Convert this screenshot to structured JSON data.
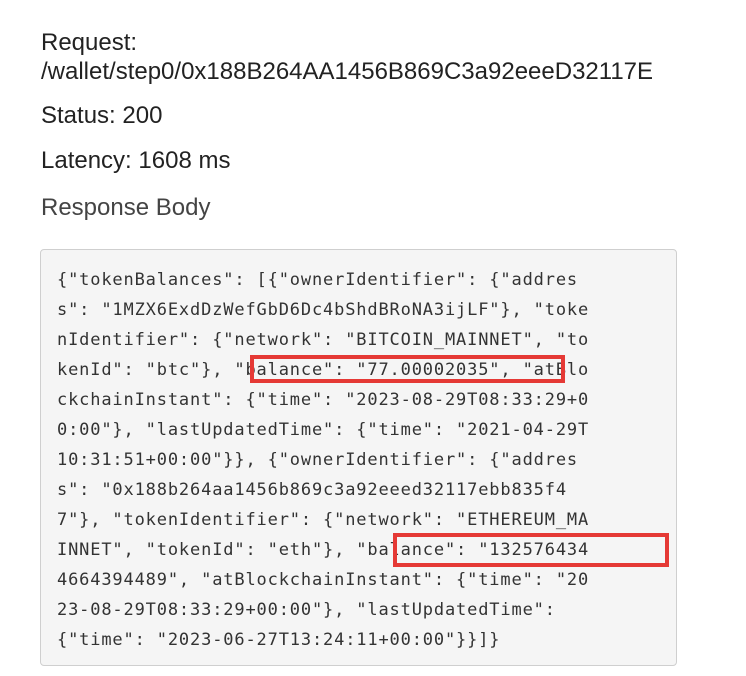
{
  "request": {
    "label": "Request:",
    "url": "/wallet/step0/0x188B264AA1456B869C3a92eeeD32117E"
  },
  "status_text": "Status: 200",
  "latency_text": "Latency: 1608 ms",
  "response_heading": "Response Body",
  "response_body_lines": [
    "{\"tokenBalances\": [{\"ownerIdentifier\": {\"addres",
    "s\": \"1MZX6ExdDzWefGbD6Dc4bShdBRoNA3ijLF\"}, \"toke",
    "nIdentifier\": {\"network\": \"BITCOIN_MAINNET\", \"to",
    "kenId\": \"btc\"}, \"balance\": \"77.00002035\", \"atBlo",
    "ckchainInstant\": {\"time\": \"2023-08-29T08:33:29+0",
    "0:00\"}, \"lastUpdatedTime\": {\"time\": \"2021-04-29T",
    "10:31:51+00:00\"}}, {\"ownerIdentifier\": {\"addres",
    "s\": \"0x188b264aa1456b869c3a92eeed32117ebb835f4",
    "7\"}, \"tokenIdentifier\": {\"network\": \"ETHEREUM_MA",
    "INNET\", \"tokenId\": \"eth\"}, \"balance\": \"132576434",
    "4664394489\", \"atBlockchainInstant\": {\"time\": \"20",
    "23-08-29T08:33:29+00:00\"}, \"lastUpdatedTime\":",
    "{\"time\": \"2023-06-27T13:24:11+00:00\"}}]}"
  ],
  "highlight_color": "#e53935"
}
